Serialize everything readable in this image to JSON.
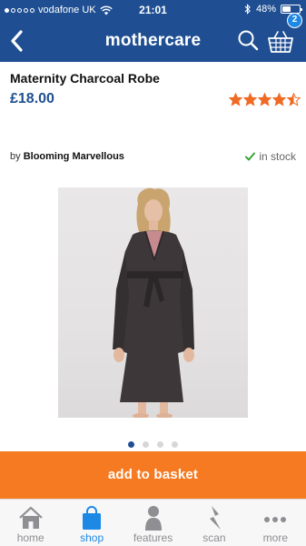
{
  "status_bar": {
    "carrier": "vodafone UK",
    "time": "21:01",
    "battery": "48%",
    "battery_level": 0.48
  },
  "nav": {
    "brand": "mothercare",
    "basket_count": "2"
  },
  "product": {
    "title": "Maternity Charcoal Robe",
    "price": "£18.00",
    "rating": 4.5,
    "brand_prefix": "by",
    "brand": "Blooming Marvellous",
    "stock": "in stock"
  },
  "carousel": {
    "total": 4,
    "active_index": 0
  },
  "cta": {
    "label": "add to basket"
  },
  "tabs": [
    {
      "label": "home",
      "icon": "home-icon"
    },
    {
      "label": "shop",
      "icon": "shopping-bag-icon"
    },
    {
      "label": "features",
      "icon": "features-icon"
    },
    {
      "label": "scan",
      "icon": "scan-icon"
    },
    {
      "label": "more",
      "icon": "more-icon"
    }
  ],
  "colors": {
    "brand_blue": "#1f4f92",
    "accent_orange": "#f57a21",
    "active_tab": "#1e88e5",
    "rating_star": "#ef6a24",
    "stock_check": "#3aa635"
  }
}
